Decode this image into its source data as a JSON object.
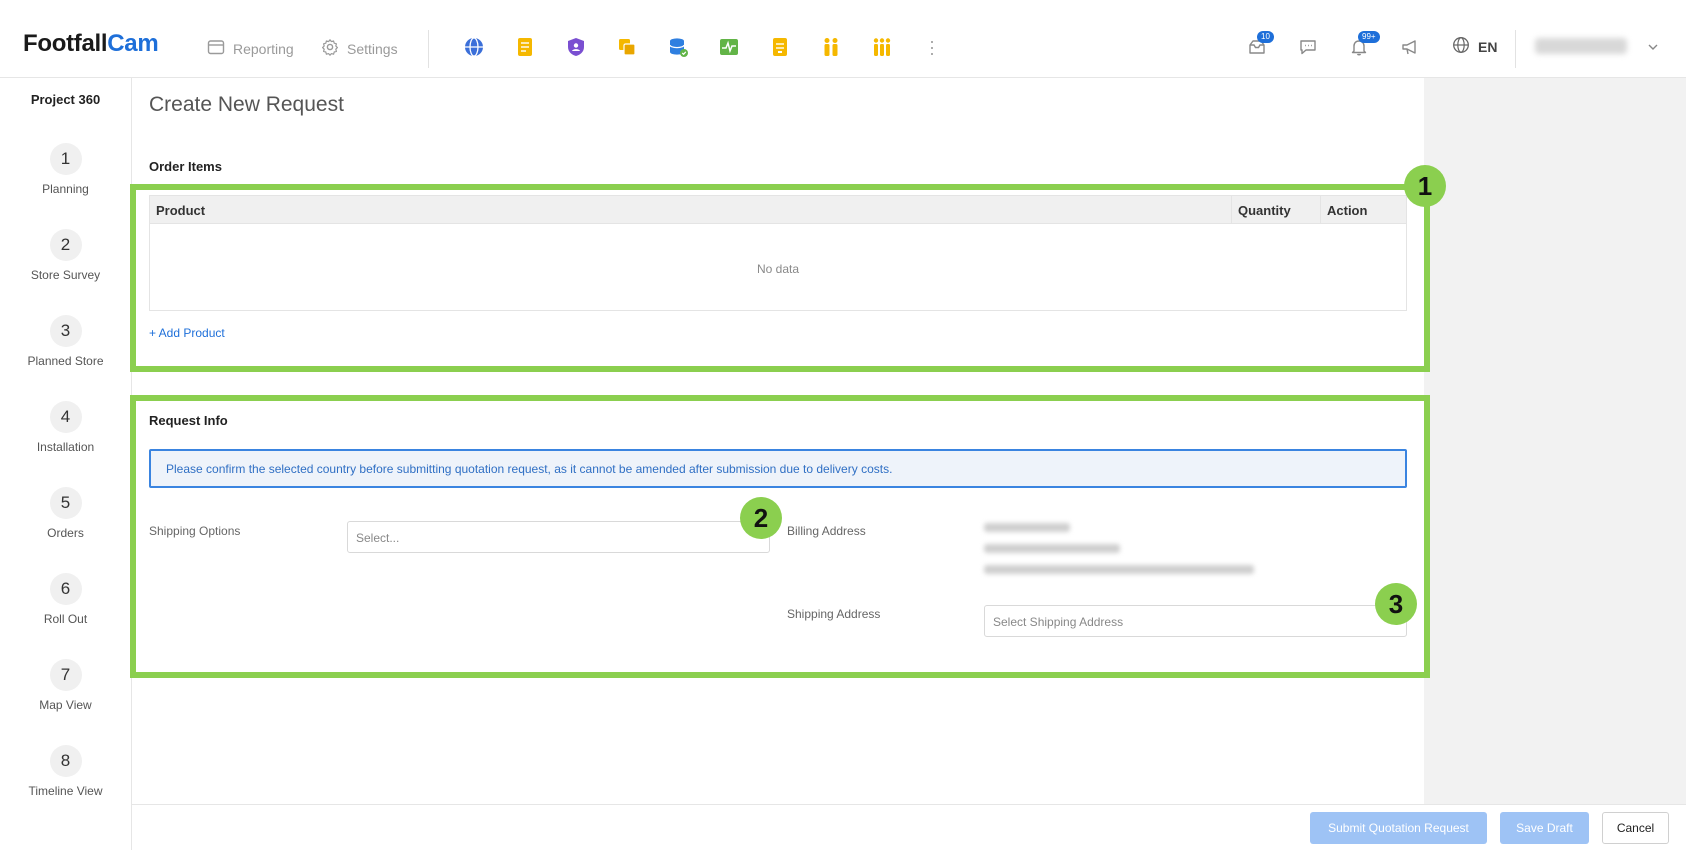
{
  "header": {
    "logo_part1": "Footfall",
    "logo_part2": "Cam",
    "nav": {
      "reporting": "Reporting",
      "settings": "Settings"
    },
    "apps": [
      {
        "icon": "globe-app-icon",
        "color": "#3b6fd9"
      },
      {
        "icon": "document-app-icon",
        "color": "#f5b800"
      },
      {
        "icon": "shield-app-icon",
        "color": "#7a4fd1"
      },
      {
        "icon": "layers-app-icon",
        "color": "#f5b800"
      },
      {
        "icon": "database-app-icon",
        "color": "#2f7fe0"
      },
      {
        "icon": "health-app-icon",
        "color": "#62b447"
      },
      {
        "icon": "report-app-icon",
        "color": "#f5b800"
      },
      {
        "icon": "people-app-icon",
        "color": "#f5b800"
      },
      {
        "icon": "group-app-icon",
        "color": "#f5b800"
      }
    ],
    "notifications": {
      "inbox_count": "10",
      "alerts_count": "99+"
    },
    "language": "EN"
  },
  "sidebar": {
    "project": "Project 360",
    "steps": [
      {
        "num": "1",
        "label": "Planning"
      },
      {
        "num": "2",
        "label": "Store Survey"
      },
      {
        "num": "3",
        "label": "Planned Store"
      },
      {
        "num": "4",
        "label": "Installation"
      },
      {
        "num": "5",
        "label": "Orders"
      },
      {
        "num": "6",
        "label": "Roll Out"
      },
      {
        "num": "7",
        "label": "Map View"
      },
      {
        "num": "8",
        "label": "Timeline View"
      }
    ]
  },
  "main": {
    "title": "Create New Request",
    "order_items": {
      "title": "Order Items",
      "columns": [
        "Product",
        "Quantity",
        "Action"
      ],
      "empty_text": "No data",
      "add_link": "+ Add Product"
    },
    "request_info": {
      "title": "Request Info",
      "notice": "Please confirm the selected country before submitting quotation request, as it cannot be amended after submission due to delivery costs.",
      "shipping_options_label": "Shipping Options",
      "shipping_options_placeholder": "Select...",
      "billing_address_label": "Billing Address",
      "shipping_address_label": "Shipping Address",
      "shipping_address_placeholder": "Select Shipping Address"
    }
  },
  "annotations": {
    "marker1": "1",
    "marker2": "2",
    "marker3": "3",
    "highlight_color": "#8bcf4f"
  },
  "footer": {
    "submit": "Submit Quotation Request",
    "save_draft": "Save Draft",
    "cancel": "Cancel"
  }
}
